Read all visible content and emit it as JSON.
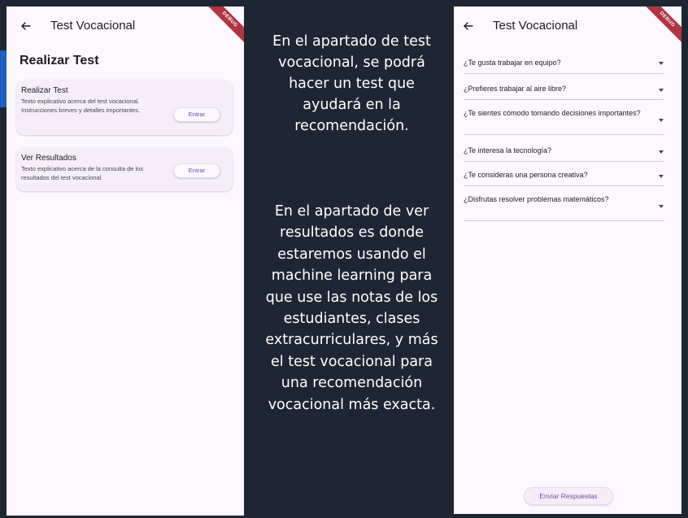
{
  "left_screen": {
    "appbar_title": "Test Vocacional",
    "page_title": "Realizar Test",
    "debug_banner": "DEBUG",
    "cards": [
      {
        "title": "Realizar Test",
        "description": "Texto explicativo acerca del test vocacional. Instrucciones breves y detalles importantes.",
        "button": "Entrar"
      },
      {
        "title": "Ver Resultados",
        "description": "Texto explicativo acerca de la consulta de los resultados del test vocacional.",
        "button": "Entrar"
      }
    ]
  },
  "middle": {
    "paragraph_1": "En el apartado de test vocacional, se podrá hacer un test que ayudará en la recomendación.",
    "paragraph_2": "En el apartado de ver resultados es donde estaremos usando el machine learning para que use las notas de los estudiantes, clases extracurriculares, y más el test vocacional para una recomendación vocacional más exacta."
  },
  "right_screen": {
    "appbar_title": "Test Vocacional",
    "debug_banner": "DEBUG",
    "questions": [
      "¿Te gusta trabajar en equipo?",
      "¿Prefieres trabajar al aire libre?",
      "¿Te sientes cómodo tomando decisiones importantes?",
      "¿Te interesa la tecnología?",
      "¿Te consideras una persona creativa?",
      "¿Disfrutas resolver problemas matemáticos?"
    ],
    "submit_button": "Enviar Respuestas"
  },
  "colors": {
    "background": "#1f2633",
    "surface": "#fdf7ff",
    "accent": "#6750a4",
    "debug": "#b03540"
  }
}
